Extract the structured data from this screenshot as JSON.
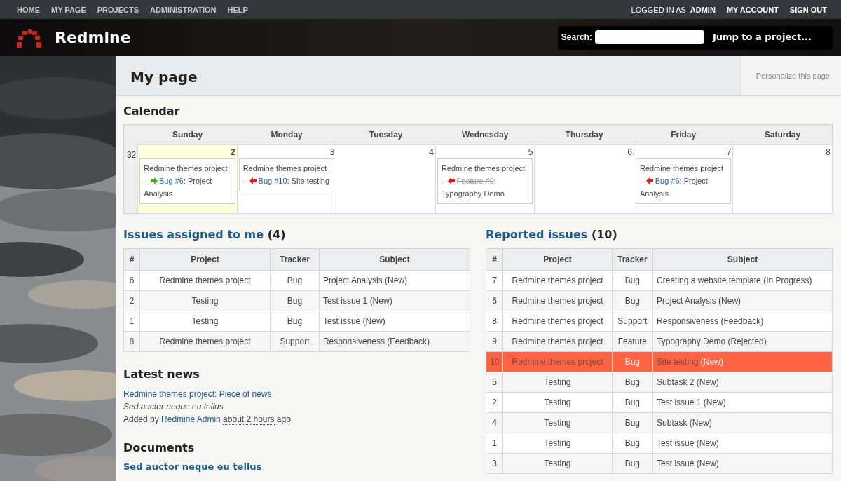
{
  "top_menu": [
    {
      "label": "HOME"
    },
    {
      "label": "MY PAGE"
    },
    {
      "label": "PROJECTS"
    },
    {
      "label": "ADMINISTRATION"
    },
    {
      "label": "HELP"
    }
  ],
  "account": {
    "logged_in_label": "LOGGED IN AS",
    "user": "ADMIN",
    "links": [
      "MY ACCOUNT",
      "SIGN OUT"
    ]
  },
  "header": {
    "title": "Redmine",
    "search_label": "Search:",
    "jump": "Jump to a project..."
  },
  "page": {
    "title": "My page",
    "personalize": "Personalize this page"
  },
  "calendar": {
    "title": "Calendar",
    "days": [
      "Sunday",
      "Monday",
      "Tuesday",
      "Wednesday",
      "Thursday",
      "Friday",
      "Saturday"
    ],
    "week": "32",
    "cells": [
      {
        "day": "2",
        "today": true,
        "events": [
          {
            "project": "Redmine themes project",
            "separator": "-",
            "kind": "starts",
            "issue": "Bug #6",
            "subject": ": Project Analysis",
            "closed": false
          }
        ]
      },
      {
        "day": "3",
        "today": false,
        "events": [
          {
            "project": "Redmine themes project",
            "separator": "-",
            "kind": "ends",
            "issue": "Bug #10",
            "subject": ": Site testing",
            "closed": false
          }
        ]
      },
      {
        "day": "4",
        "today": false
      },
      {
        "day": "5",
        "today": false,
        "events": [
          {
            "project": "Redmine themes project",
            "separator": "-",
            "kind": "ends",
            "issue": "Feature #9",
            "subject": ": Typography Demo",
            "closed": true
          }
        ]
      },
      {
        "day": "6",
        "today": false
      },
      {
        "day": "7",
        "today": false,
        "events": [
          {
            "project": "Redmine themes project",
            "separator": "-",
            "kind": "ends",
            "issue": "Bug #6",
            "subject": ": Project Analysis",
            "closed": false
          }
        ]
      },
      {
        "day": "8",
        "today": false
      }
    ]
  },
  "assigned": {
    "title": "Issues assigned to me",
    "count": "(4)",
    "columns": [
      "#",
      "Project",
      "Tracker",
      "Subject"
    ],
    "rows": [
      {
        "id": "6",
        "project": "Redmine themes project",
        "tracker": "Bug",
        "subject": "Project Analysis",
        "status": "(New)",
        "highlighted": false,
        "hovered": false
      },
      {
        "id": "2",
        "project": "Testing",
        "tracker": "Bug",
        "subject": "Test issue 1",
        "status": "(New)",
        "highlighted": false,
        "hovered": false
      },
      {
        "id": "1",
        "project": "Testing",
        "tracker": "Bug",
        "subject": "Test issue",
        "status": "(New)",
        "highlighted": false,
        "hovered": true
      },
      {
        "id": "8",
        "project": "Redmine themes project",
        "tracker": "Support",
        "subject": "Responsiveness",
        "status": "(Feedback)",
        "highlighted": false,
        "hovered": false
      }
    ]
  },
  "reported": {
    "title": "Reported issues",
    "count": "(10)",
    "columns": [
      "#",
      "Project",
      "Tracker",
      "Subject"
    ],
    "rows": [
      {
        "id": "7",
        "project": "Redmine themes project",
        "tracker": "Bug",
        "subject": "Creating a website template",
        "status": "(In Progress)",
        "highlighted": false,
        "hovered": false
      },
      {
        "id": "6",
        "project": "Redmine themes project",
        "tracker": "Bug",
        "subject": "Project Analysis",
        "status": "(New)",
        "highlighted": false,
        "hovered": false
      },
      {
        "id": "8",
        "project": "Redmine themes project",
        "tracker": "Support",
        "subject": "Responsiveness",
        "status": "(Feedback)",
        "highlighted": false,
        "hovered": false
      },
      {
        "id": "9",
        "project": "Redmine themes project",
        "tracker": "Feature",
        "subject": "Typography Demo",
        "status": "(Rejected)",
        "highlighted": false,
        "hovered": false
      },
      {
        "id": "10",
        "project": "Redmine themes project",
        "tracker": "Bug",
        "subject": "Site testing",
        "status": "(New)",
        "highlighted": true,
        "hovered": false
      },
      {
        "id": "5",
        "project": "Testing",
        "tracker": "Bug",
        "subject": "Subtask 2",
        "status": "(New)",
        "highlighted": false,
        "hovered": false
      },
      {
        "id": "2",
        "project": "Testing",
        "tracker": "Bug",
        "subject": "Test issue 1",
        "status": "(New)",
        "highlighted": false,
        "hovered": false
      },
      {
        "id": "4",
        "project": "Testing",
        "tracker": "Bug",
        "subject": "Subtask",
        "status": "(New)",
        "highlighted": false,
        "hovered": false
      },
      {
        "id": "1",
        "project": "Testing",
        "tracker": "Bug",
        "subject": "Test issue",
        "status": "(New)",
        "highlighted": false,
        "hovered": false
      },
      {
        "id": "3",
        "project": "Testing",
        "tracker": "Bug",
        "subject": "Test issue",
        "status": "(New)",
        "highlighted": false,
        "hovered": false
      }
    ]
  },
  "news": {
    "title": "Latest news",
    "items": [
      {
        "headline": "Redmine themes project: Piece of news",
        "summary": "Sed auctor neque eu tellus",
        "added_by": "Added by",
        "author": "Redmine Admin",
        "time": "about 2 hours",
        "ago": "ago"
      }
    ]
  },
  "documents": {
    "title": "Documents",
    "items": [
      "Sed auctor neque eu tellus"
    ]
  }
}
